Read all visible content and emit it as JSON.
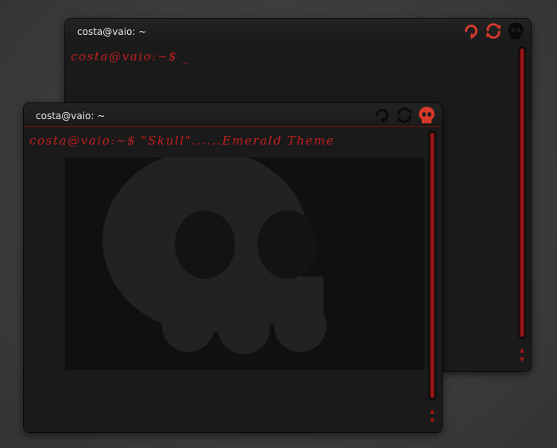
{
  "windows": {
    "back": {
      "title": "costa@vaio: ~",
      "prompt": "costa@vaio:~$ _"
    },
    "front": {
      "title": "costa@vaio: ~",
      "prompt": "costa@vaio:~$ \"Skull\"......Emerald Theme"
    }
  },
  "icons": {
    "minimize": "refresh-ccw-icon",
    "maximize": "refresh-cycle-icon",
    "close": "skull-icon"
  },
  "colors": {
    "accent": "#c41e1e",
    "icon_active": "#d93a2b",
    "icon_inactive": "#0a0a0a",
    "text": "#e6e6e6",
    "terminal_bg": "#1a1a1a",
    "desktop": "#3d3d3d"
  }
}
